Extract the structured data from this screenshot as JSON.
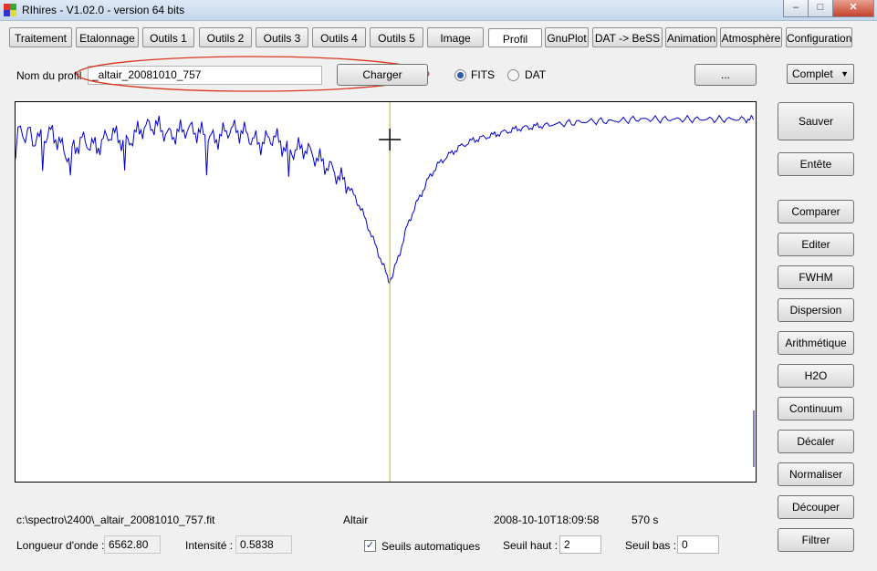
{
  "window": {
    "title": "RIhires - V1.02.0 - version 64 bits",
    "minimize": "–",
    "maximize": "□",
    "close": "✕"
  },
  "tabs": [
    "Traitement",
    "Etalonnage",
    "Outils 1",
    "Outils 2",
    "Outils 3",
    "Outils 4",
    "Outils 5",
    "Image",
    "Profil",
    "GnuPlot",
    "DAT -> BeSS",
    "Animation",
    "Atmosphère",
    "Configuration"
  ],
  "active_tab": "Profil",
  "profile": {
    "name_label": "Nom du profil",
    "name_value": "_altair_20081010_757",
    "load_label": "Charger",
    "format_options": [
      "FITS",
      "DAT"
    ],
    "format_selected": "FITS",
    "browse_label": "...",
    "mode_value": "Complet"
  },
  "side_buttons": {
    "save": "Sauver",
    "header": "Entête",
    "compare": "Comparer",
    "edit": "Editer",
    "fwhm": "FWHM",
    "dispersion": "Dispersion",
    "arithmetic": "Arithmétique",
    "h2o": "H2O",
    "continuum": "Continuum",
    "shift": "Décaler",
    "normalize": "Normaliser",
    "crop": "Découper",
    "filter": "Filtrer"
  },
  "status": {
    "file_path": "c:\\spectro\\2400\\_altair_20081010_757.fit",
    "object": "Altair",
    "date": "2008-10-10T18:09:58",
    "exposure": "570 s"
  },
  "readouts": {
    "wavelength_label": "Longueur d'onde :",
    "wavelength_value": "6562.80",
    "intensity_label": "Intensité :",
    "intensity_value": "0.5838",
    "auto_thresholds_label": "Seuils automatiques",
    "auto_thresholds_checked": true,
    "high_threshold_label": "Seuil haut :",
    "high_threshold_value": "2",
    "low_threshold_label": "Seuil bas :",
    "low_threshold_value": "0"
  },
  "colors": {
    "spectrum": "#0000cc",
    "cursor_line": "#c8b400",
    "ellipse": "#d9361f"
  },
  "chart_data": {
    "type": "line",
    "title": "",
    "xlabel": "",
    "ylabel": "",
    "cursor_x_fraction": 0.507,
    "series": [
      {
        "x": [
          0.0,
          0.03,
          0.05,
          0.07,
          0.09,
          0.11,
          0.13,
          0.15,
          0.17,
          0.19,
          0.21,
          0.23,
          0.25,
          0.27,
          0.29,
          0.31,
          0.33,
          0.35,
          0.37,
          0.39,
          0.41,
          0.43,
          0.45,
          0.46,
          0.47,
          0.48,
          0.49,
          0.5,
          0.505,
          0.51,
          0.52,
          0.53,
          0.54,
          0.55,
          0.56,
          0.57,
          0.58,
          0.6,
          0.62,
          0.64,
          0.66,
          0.68,
          0.7,
          0.72,
          0.75,
          0.78,
          0.81,
          0.84,
          0.87,
          0.9,
          0.93,
          0.96,
          0.99,
          1.0
        ],
        "y": [
          0.93,
          0.9,
          0.92,
          0.86,
          0.9,
          0.88,
          0.92,
          0.89,
          0.93,
          0.94,
          0.91,
          0.93,
          0.92,
          0.9,
          0.93,
          0.92,
          0.89,
          0.91,
          0.87,
          0.88,
          0.85,
          0.82,
          0.78,
          0.75,
          0.71,
          0.66,
          0.61,
          0.56,
          0.53,
          0.54,
          0.6,
          0.67,
          0.72,
          0.76,
          0.8,
          0.83,
          0.85,
          0.88,
          0.9,
          0.91,
          0.92,
          0.93,
          0.935,
          0.94,
          0.945,
          0.95,
          0.95,
          0.955,
          0.955,
          0.955,
          0.955,
          0.955,
          0.955,
          0.955
        ]
      }
    ]
  }
}
